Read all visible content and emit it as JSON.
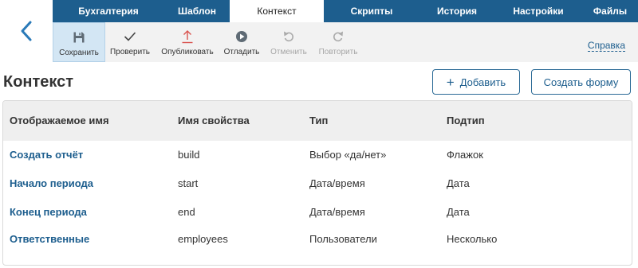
{
  "tabs": [
    {
      "label": "Бухгалтерия",
      "active": false
    },
    {
      "label": "Шаблон",
      "active": false
    },
    {
      "label": "Контекст",
      "active": true
    },
    {
      "label": "Скрипты",
      "active": false
    },
    {
      "label": "История",
      "active": false
    },
    {
      "label": "Настройки",
      "active": false
    },
    {
      "label": "Файлы",
      "active": false
    }
  ],
  "toolbar": {
    "items": [
      {
        "label": "Сохранить",
        "icon": "save-icon",
        "active": true,
        "disabled": false
      },
      {
        "label": "Проверить",
        "icon": "check-icon",
        "active": false,
        "disabled": false
      },
      {
        "label": "Опубликовать",
        "icon": "publish-icon",
        "active": false,
        "disabled": false
      },
      {
        "label": "Отладить",
        "icon": "debug-play-icon",
        "active": false,
        "disabled": false
      },
      {
        "label": "Отменить",
        "icon": "undo-icon",
        "active": false,
        "disabled": true
      },
      {
        "label": "Повторить",
        "icon": "redo-icon",
        "active": false,
        "disabled": true
      }
    ],
    "help_label": "Справка"
  },
  "page": {
    "title": "Контекст",
    "add_button": "Добавить",
    "create_form_button": "Создать форму"
  },
  "table": {
    "columns": [
      "Отображаемое имя",
      "Имя свойства",
      "Тип",
      "Подтип"
    ],
    "rows": [
      [
        "Создать отчёт",
        "build",
        "Выбор «да/нет»",
        "Флажок"
      ],
      [
        "Начало периода",
        "start",
        "Дата/время",
        "Дата"
      ],
      [
        "Конец периода",
        "end",
        "Дата/время",
        "Дата"
      ],
      [
        "Ответственные",
        "employees",
        "Пользователи",
        "Несколько"
      ]
    ]
  },
  "colors": {
    "brand": "#1d5e8e",
    "publish_accent": "#d9534f",
    "toolbar_bg": "#f2f2f2"
  }
}
